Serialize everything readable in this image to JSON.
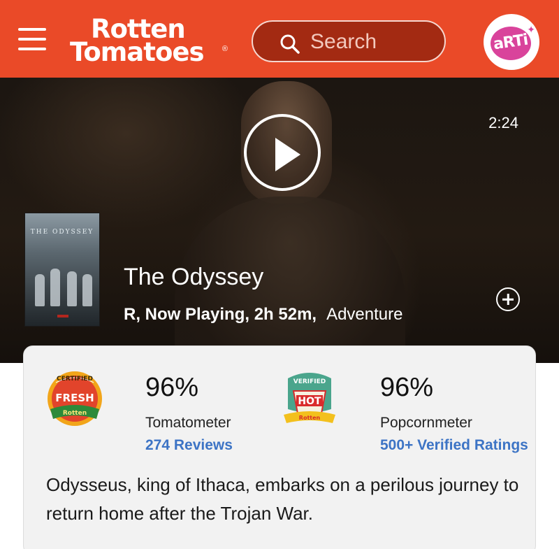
{
  "header": {
    "logo_line1": "Rotten",
    "logo_line2": "Tomatoes",
    "logo_reg": "®",
    "search_placeholder": "Search",
    "avatar_text": "aRTi"
  },
  "hero": {
    "duration": "2:24",
    "title": "The Odyssey",
    "meta": "R, Now Playing, 2h 52m,",
    "genre": "Adventure",
    "poster_title": "THE ODYSSEY"
  },
  "scores": {
    "tomatometer": {
      "badge_top": "CERTIFIED",
      "badge_main": "FRESH",
      "percent": "96%",
      "label": "Tomatometer",
      "link": "274 Reviews"
    },
    "popcornmeter": {
      "badge_top": "VERIFIED",
      "badge_main": "HOT",
      "percent": "96%",
      "label": "Popcornmeter",
      "link": "500+ Verified Ratings"
    }
  },
  "synopsis": "Odysseus, king of Ithaca, embarks on a perilous journey to return home after the Trojan War.",
  "colors": {
    "brand": "#ea4a28",
    "link": "#3d74c5",
    "card_bg": "#f2f2f2"
  }
}
